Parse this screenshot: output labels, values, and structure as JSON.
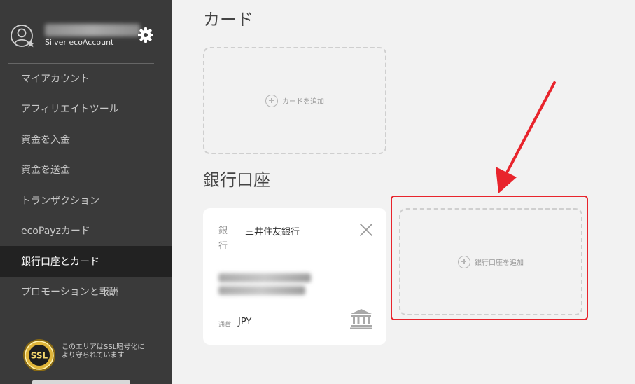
{
  "sidebar": {
    "account_tier": "Silver ecoAccount",
    "nav_items": [
      {
        "label": "マイアカウント"
      },
      {
        "label": "アフィリエイトツール"
      },
      {
        "label": "資金を入金"
      },
      {
        "label": "資金を送金"
      },
      {
        "label": "トランザクション"
      },
      {
        "label": "ecoPayzカード"
      },
      {
        "label": "銀行口座とカード",
        "active": true
      },
      {
        "label": "プロモーションと報酬"
      }
    ],
    "ssl_badge_text": "SSL",
    "ssl_notice": "このエリアはSSL暗号化により守られています"
  },
  "main": {
    "cards_section": {
      "title": "カード",
      "add_label": "カードを追加"
    },
    "bank_section": {
      "title": "銀行口座",
      "bank_card": {
        "bank_label": "銀行",
        "bank_name": "三井住友銀行",
        "currency_label": "通貨",
        "currency_value": "JPY"
      },
      "add_label": "銀行口座を追加"
    }
  },
  "icons": {
    "avatar": "user-avatar-icon",
    "settings": "gear-icon",
    "remove": "close-icon",
    "bank": "bank-building-icon",
    "add": "plus-circle-icon",
    "ssl": "ssl-seal-icon"
  },
  "colors": {
    "sidebar_bg": "#3a3a3a",
    "active_item_bg": "#222222",
    "main_bg": "#f2f2f2",
    "highlight": "#e8242c"
  }
}
